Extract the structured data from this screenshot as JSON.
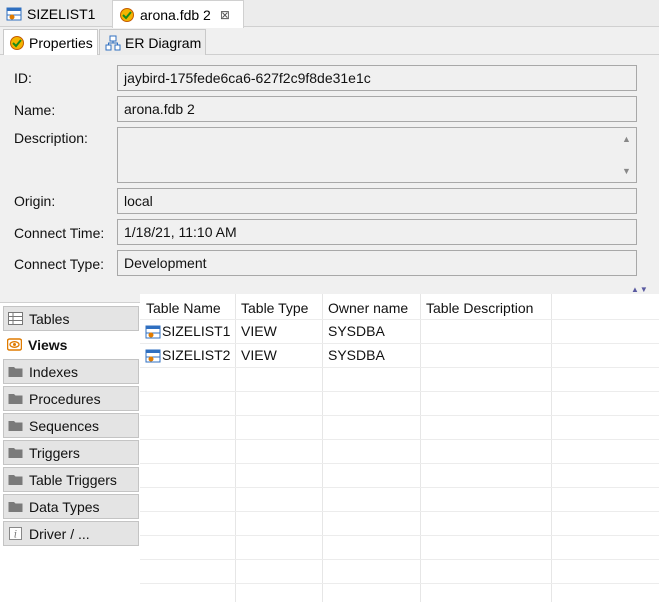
{
  "editor_tabs": [
    {
      "label": "SIZELIST1",
      "icon": "view-table-icon",
      "active": false
    },
    {
      "label": "arona.fdb 2",
      "icon": "database-connection-icon",
      "active": true,
      "close": "⊠"
    }
  ],
  "sub_tabs": [
    {
      "label": "Properties",
      "icon": "properties-icon",
      "active": true
    },
    {
      "label": "ER Diagram",
      "icon": "er-diagram-icon",
      "active": false
    }
  ],
  "properties": {
    "id_label": "ID:",
    "id_value": "jaybird-175fede6ca6-627f2c9f8de31e1c",
    "name_label": "Name:",
    "name_value": "arona.fdb 2",
    "description_label": "Description:",
    "description_value": "",
    "origin_label": "Origin:",
    "origin_value": "local",
    "connect_time_label": "Connect Time:",
    "connect_time_value": "1/18/21, 11:10 AM",
    "connect_type_label": "Connect Type:",
    "connect_type_value": "Development"
  },
  "categories": [
    {
      "label": "Tables",
      "icon": "table-icon",
      "active": false
    },
    {
      "label": "Views",
      "icon": "eye-icon",
      "active": true
    },
    {
      "label": "Indexes",
      "icon": "folder-icon",
      "active": false
    },
    {
      "label": "Procedures",
      "icon": "folder-icon",
      "active": false
    },
    {
      "label": "Sequences",
      "icon": "folder-icon",
      "active": false
    },
    {
      "label": "Triggers",
      "icon": "folder-icon",
      "active": false
    },
    {
      "label": "Table Triggers",
      "icon": "folder-icon",
      "active": false
    },
    {
      "label": "Data Types",
      "icon": "folder-icon",
      "active": false
    },
    {
      "label": "Driver / ...",
      "icon": "info-icon",
      "active": false
    }
  ],
  "table": {
    "columns": [
      "Table Name",
      "Table Type",
      "Owner name",
      "Table Description"
    ],
    "rows": [
      [
        "SIZELIST1",
        "VIEW",
        "SYSDBA",
        ""
      ],
      [
        "SIZELIST2",
        "VIEW",
        "SYSDBA",
        ""
      ]
    ]
  },
  "colors": {
    "views_icon": "#e07b00",
    "table_icon_blue": "#2f6fc0",
    "folder_gray": "#7a7a7a"
  }
}
